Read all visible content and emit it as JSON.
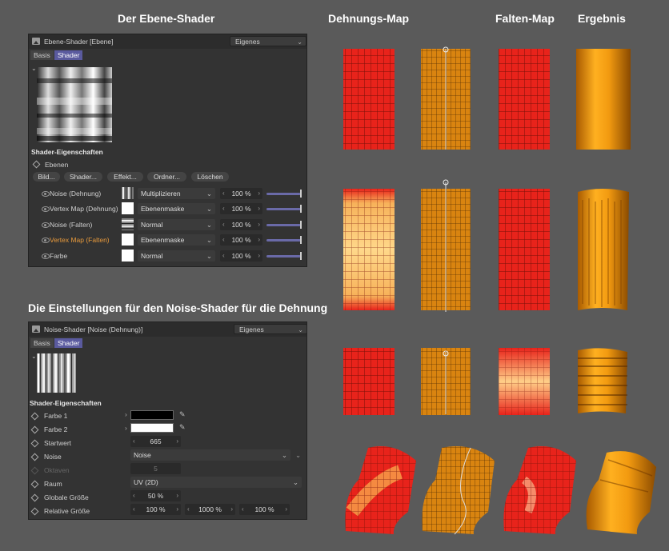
{
  "headings": {
    "ebene_shader": "Der Ebene-Shader",
    "dehnungs_map": "Dehnungs-Map",
    "falten_map": "Falten-Map",
    "ergebnis": "Ergebnis",
    "noise_settings": "Die Einstellungen für den Noise-Shader für die Dehnung"
  },
  "ebene_panel": {
    "title": "Ebene-Shader [Ebene]",
    "mode": "Eigenes",
    "tabs": [
      "Basis",
      "Shader"
    ],
    "section": "Shader-Eigenschaften",
    "ebenen_label": "Ebenen",
    "buttons": [
      "Bild...",
      "Shader...",
      "Effekt...",
      "Ordner...",
      "Löschen"
    ],
    "layers": [
      {
        "name": "Noise (Dehnung)",
        "mode": "Multiplizieren",
        "value": "100 %",
        "highlight": false
      },
      {
        "name": "Vertex Map (Dehnung)",
        "mode": "Ebenenmaske",
        "value": "100 %",
        "highlight": false
      },
      {
        "name": "Noise (Falten)",
        "mode": "Normal",
        "value": "100 %",
        "highlight": false
      },
      {
        "name": "Vertex Map (Falten)",
        "mode": "Ebenenmaske",
        "value": "100 %",
        "highlight": true
      },
      {
        "name": "Farbe",
        "mode": "Normal",
        "value": "100 %",
        "highlight": false
      }
    ]
  },
  "noise_panel": {
    "title": "Noise-Shader [Noise (Dehnung)]",
    "mode": "Eigenes",
    "tabs": [
      "Basis",
      "Shader"
    ],
    "section": "Shader-Eigenschaften",
    "props": {
      "farbe1": {
        "label": "Farbe 1",
        "color": "#000000"
      },
      "farbe2": {
        "label": "Farbe 2",
        "color": "#ffffff"
      },
      "startwert": {
        "label": "Startwert",
        "value": "665"
      },
      "noise": {
        "label": "Noise",
        "value": "Noise"
      },
      "oktaven": {
        "label": "Oktaven",
        "value": "5"
      },
      "raum": {
        "label": "Raum",
        "value": "UV (2D)"
      },
      "globale": {
        "label": "Globale Größe",
        "value": "50 %"
      },
      "relative": {
        "label": "Relative Größe",
        "v1": "100 %",
        "v2": "1000 %",
        "v3": "100 %"
      }
    }
  },
  "colors": {
    "red": "#e8231b",
    "orange": "#d98410",
    "highlight": "#e89a3c",
    "slider": "#6a6aa8",
    "active_tab": "#5a5a9e"
  }
}
